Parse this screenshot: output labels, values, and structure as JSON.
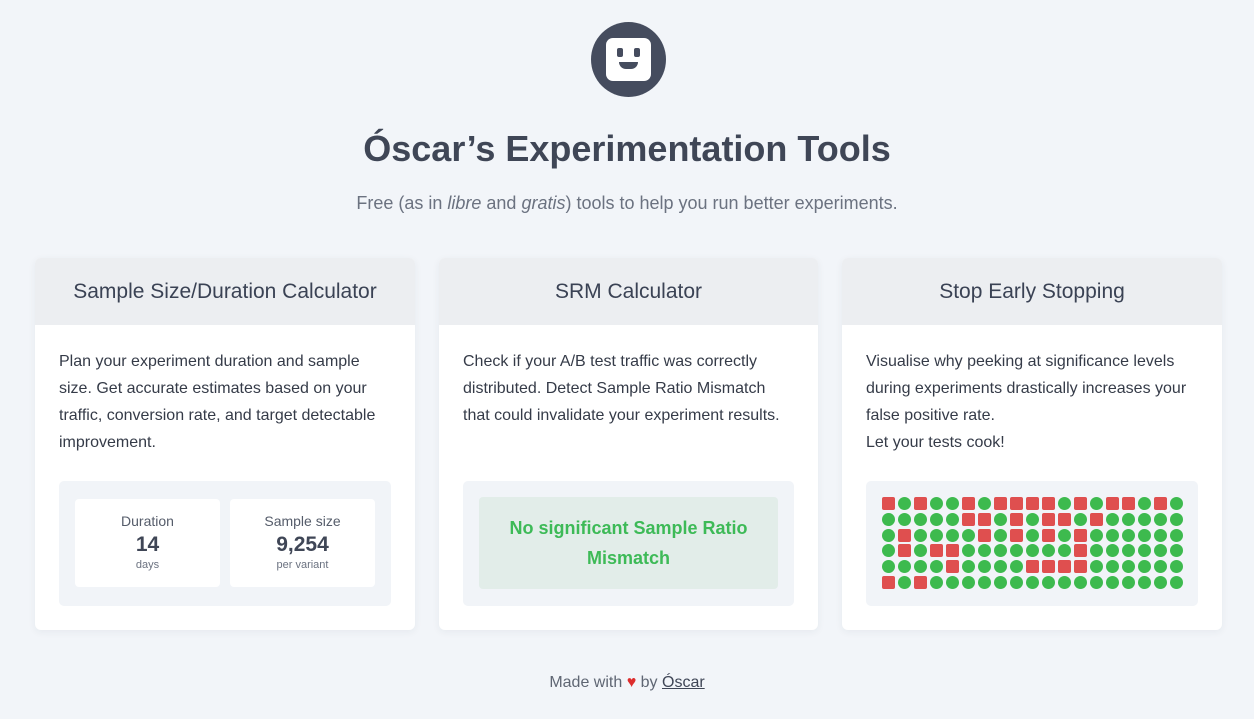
{
  "header": {
    "logo_icon": "robot-face-icon",
    "title": "Óscar’s Experimentation Tools",
    "subtitle_parts": [
      "Free (as in ",
      "libre",
      " and ",
      "gratis",
      ") tools to help you run better experiments."
    ]
  },
  "cards": [
    {
      "title": "Sample Size/Duration Calculator",
      "description": "Plan your experiment duration and sample size. Get accurate estimates based on your traffic, conversion rate, and target detectable improvement.",
      "stats": [
        {
          "label": "Duration",
          "value": "14",
          "unit": "days"
        },
        {
          "label": "Sample size",
          "value": "9,254",
          "unit": "per variant"
        }
      ]
    },
    {
      "title": "SRM Calculator",
      "description": "Check if your A/B test traffic was correctly distributed. Detect Sample Ratio Mismatch that could invalidate your experiment results.",
      "result": "No significant Sample Ratio Mismatch"
    },
    {
      "title": "Stop Early Stopping",
      "description_lines": [
        "Visualise why peeking at significance levels during experiments drastically increases your false positive rate.",
        "Let your tests cook!"
      ],
      "grid_colors": {
        "significant": "#df4f4f",
        "not_significant": "#3dba4e"
      },
      "grid_rows": [
        "SCSCCSCSSSSCSCSSCSC",
        "CCCCCSSCSCSSCSCCCCC",
        "CSCCCCSCSCSCSCCCCCC",
        "CSCSSCCCCCCCSCCCCCC",
        "CCCCSCCCCSSSSCCCCCC",
        "SCSCCCCCCCCCCCCCCCC"
      ]
    }
  ],
  "footer": {
    "prefix": "Made with",
    "heart_icon": "heart-icon",
    "heart": "♥",
    "by": "by",
    "author_link": "Óscar"
  }
}
